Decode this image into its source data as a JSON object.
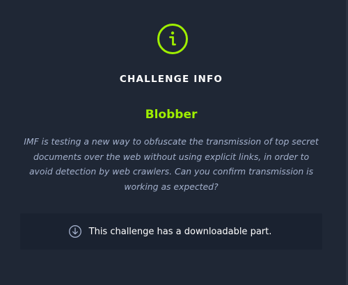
{
  "dialog": {
    "title": "CHALLENGE INFO",
    "icon": "info-icon",
    "accent_color": "#9fef00",
    "challenge_name": "Blobber",
    "description": "IMF is testing a new way to obfuscate the transmission of top secret documents over the web without using explicit links, in order to avoid detection by web crawlers. Can you confirm transmission is working as expected?",
    "download_notice": {
      "icon": "download-icon",
      "text": "This challenge has a downloadable part."
    }
  }
}
